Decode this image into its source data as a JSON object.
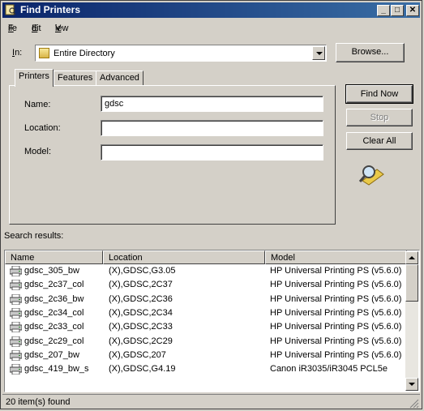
{
  "window": {
    "title": "Find Printers",
    "min": "_",
    "max": "□",
    "close": "✕"
  },
  "menu": [
    {
      "label": "File",
      "key": "F",
      "rest": "ile"
    },
    {
      "label": "Edit",
      "key": "E",
      "rest": "dit"
    },
    {
      "label": "View",
      "key": "V",
      "rest": "iew"
    }
  ],
  "in_label": {
    "key": "I",
    "rest": "n:"
  },
  "scope": {
    "value": "Entire Directory",
    "icon": "directory-icon"
  },
  "browse_label": "Browse...",
  "tabs": [
    "Printers",
    "Features",
    "Advanced"
  ],
  "form": {
    "name_label": "Name:",
    "name_value": "gdsc",
    "location_label": "Location:",
    "location_value": "",
    "model_label": "Model:",
    "model_value": ""
  },
  "buttons": {
    "find_now": "Find Now",
    "stop": "Stop",
    "clear_all": "Clear All"
  },
  "search_icon": "magnifier-search-icon",
  "results_label": "Search results:",
  "columns": [
    "Name",
    "Location",
    "Model"
  ],
  "rows": [
    [
      "gdsc_305_bw",
      "(X),GDSC,G3.05",
      "HP Universal Printing PS (v5.6.0)"
    ],
    [
      "gdsc_2c37_col",
      "(X),GDSC,2C37",
      "HP Universal Printing PS (v5.6.0)"
    ],
    [
      "gdsc_2c36_bw",
      "(X),GDSC,2C36",
      "HP Universal Printing PS (v5.6.0)"
    ],
    [
      "gdsc_2c34_col",
      "(X),GDSC,2C34",
      "HP Universal Printing PS (v5.6.0)"
    ],
    [
      "gdsc_2c33_col",
      "(X),GDSC,2C33",
      "HP Universal Printing PS (v5.6.0)"
    ],
    [
      "gdsc_2c29_col",
      "(X),GDSC,2C29",
      "HP Universal Printing PS (v5.6.0)"
    ],
    [
      "gdsc_207_bw",
      "(X),GDSC,207",
      "HP Universal Printing PS (v5.6.0)"
    ],
    [
      "gdsc_419_bw_s",
      "(X),GDSC,G4.19",
      "Canon iR3035/iR3045 PCL5e"
    ]
  ],
  "status": "20 item(s) found",
  "colors": {
    "title_start": "#0a246a",
    "title_end": "#3a6ea5",
    "face": "#d4d0c8"
  }
}
